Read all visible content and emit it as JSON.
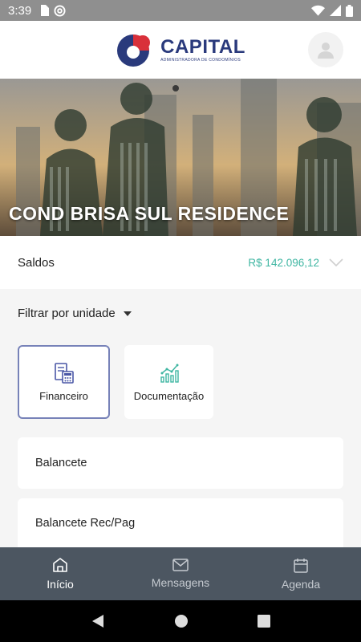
{
  "status_bar": {
    "time": "3:39",
    "left_icons": [
      "sim-card-icon",
      "at-sign-icon"
    ],
    "right_icons": [
      "wifi-icon",
      "cell-signal-icon",
      "battery-icon"
    ]
  },
  "app_bar": {
    "logo_title": "CAPITAL",
    "logo_subtitle": "ADMINISTRADORA DE CONDOMÍNIOS",
    "avatar_icon": "user-avatar-icon"
  },
  "banner": {
    "title": "COND BRISA SUL RESIDENCE"
  },
  "saldos": {
    "label": "Saldos",
    "value": "R$ 142.096,12"
  },
  "filter": {
    "label": "Filtrar por unidade"
  },
  "tiles": [
    {
      "label": "Financeiro",
      "icon": "financial-report-icon",
      "selected": true
    },
    {
      "label": "Documentação",
      "icon": "chart-growth-icon",
      "selected": false
    }
  ],
  "list": [
    {
      "label": "Balancete"
    },
    {
      "label": "Balancete Rec/Pag"
    }
  ],
  "bottom_nav": [
    {
      "label": "Início",
      "icon": "home-icon",
      "active": true
    },
    {
      "label": "Mensagens",
      "icon": "mail-icon",
      "active": false
    },
    {
      "label": "Agenda",
      "icon": "calendar-icon",
      "active": false
    }
  ],
  "colors": {
    "accent_teal": "#3fb6a2",
    "brand_navy": "#2a3a7c",
    "brand_red": "#d9303a",
    "nav_bg": "#4c5661"
  }
}
